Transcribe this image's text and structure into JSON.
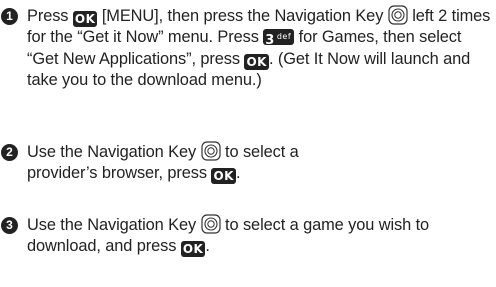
{
  "steps": [
    {
      "number": "1",
      "t1": "Press",
      "t2": "[MENU], then press the Navigation Key",
      "t3": "left 2 times for the “Get it Now” menu. Press",
      "t4": "for Games, then select “Get New Applications”, press",
      "t5": ". (Get It Now will launch and take you to the download menu.)"
    },
    {
      "number": "2",
      "t1": "Use the Navigation Key",
      "t2": "to select a provider’s browser, press",
      "t3": "."
    },
    {
      "number": "3",
      "t1": "Use the Navigation Key",
      "t2": "to select a game you wish to download, and press",
      "t3": "."
    }
  ],
  "keys": {
    "ok": "OK",
    "three_digit": "3",
    "three_letters": "def"
  },
  "icons": {
    "ok_key": "ok-key-icon",
    "nav_key": "navigation-key-icon",
    "three_key": "three-def-key-icon"
  }
}
